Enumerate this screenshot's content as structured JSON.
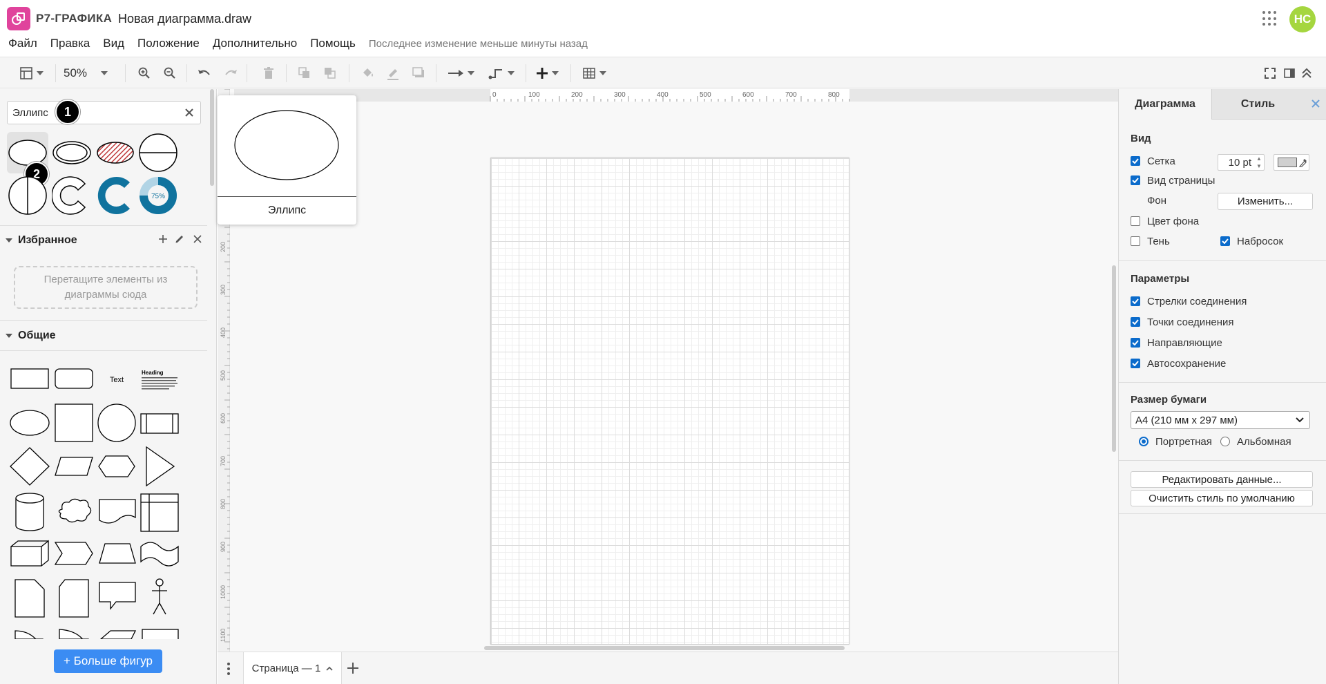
{
  "app": {
    "name": "Р7-ГРАФИКА",
    "document": "Новая диаграмма.draw",
    "user_initials": "НС"
  },
  "colors": {
    "brand": "#e0439c",
    "avatar": "#a5d63f",
    "accent": "#3b8cf3",
    "checkbox": "#0b6bcb"
  },
  "menu": {
    "items": [
      "Файл",
      "Правка",
      "Вид",
      "Положение",
      "Дополнительно",
      "Помощь"
    ],
    "status": "Последнее изменение меньше минуты назад"
  },
  "toolbar": {
    "zoom": "50%"
  },
  "search": {
    "value": "Эллипс"
  },
  "badges": {
    "first": "1",
    "second": "2"
  },
  "shape_results": [
    "ellipse",
    "double-ellipse",
    "hatched-ellipse",
    "divided-circle",
    "half-circle",
    "partial-ring",
    "thick-arc",
    "donut-75"
  ],
  "donut_label": "75%",
  "tooltip": {
    "label": "Эллипс"
  },
  "favorites": {
    "title": "Избранное",
    "placeholder_line1": "Перетащите элементы из",
    "placeholder_line2": "диаграммы сюда"
  },
  "general": {
    "title": "Общие",
    "text_shape": "Text",
    "heading_shape": "Heading"
  },
  "more_shapes": "+ Больше фигур",
  "ruler": {
    "top_ticks": [
      "0",
      "100",
      "200",
      "300",
      "400",
      "500",
      "600",
      "700",
      "800"
    ],
    "left_ticks": [
      "200",
      "300",
      "400",
      "500",
      "600",
      "700",
      "800",
      "900",
      "1000",
      "1100"
    ]
  },
  "page_tab": {
    "label": "Страница — 1"
  },
  "right_panel": {
    "tabs": [
      "Диаграмма",
      "Стиль"
    ],
    "view": {
      "title": "Вид",
      "grid": {
        "label": "Сетка",
        "checked": true,
        "size": "10 pt"
      },
      "page_view": {
        "label": "Вид страницы",
        "checked": true
      },
      "background": {
        "label": "Фон",
        "button": "Изменить..."
      },
      "bg_color": {
        "label": "Цвет фона",
        "checked": false
      },
      "shadow": {
        "label": "Тень",
        "checked": false
      },
      "sketch": {
        "label": "Набросок",
        "checked": true
      }
    },
    "options": {
      "title": "Параметры",
      "items": [
        {
          "label": "Стрелки соединения",
          "checked": true
        },
        {
          "label": "Точки соединения",
          "checked": true
        },
        {
          "label": "Направляющие",
          "checked": true
        },
        {
          "label": "Автосохранение",
          "checked": true
        }
      ]
    },
    "paper": {
      "title": "Размер бумаги",
      "selected": "A4 (210 мм x 297 мм)",
      "portrait": "Портретная",
      "landscape": "Альбомная",
      "orientation": "portrait"
    },
    "buttons": {
      "edit_data": "Редактировать данные...",
      "clear_style": "Очистить стиль по умолчанию"
    }
  }
}
